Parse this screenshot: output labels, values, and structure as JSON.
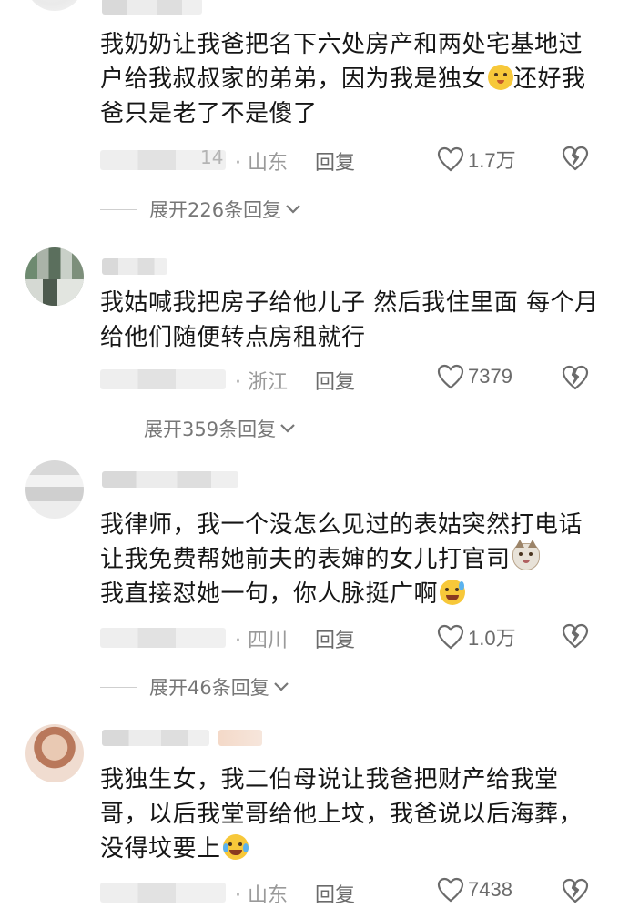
{
  "comments": [
    {
      "text": "我奶奶让我爸把名下六处房产和两处宅基地过户给我叔叔家的弟弟，因为我是独女",
      "text_after_emoji": "还好我爸只是老了不是傻了",
      "emoji_icon": "hush-face-emoji",
      "date_tail": "14",
      "location": "· 山东",
      "reply_label": "回复",
      "likes": "1.7万",
      "expand_label": "展开226条回复"
    },
    {
      "text": "我姑喊我把房子给他儿子 然后我住里面 每个月给他们随便转点房租就行",
      "date_tail": "",
      "location": "· 浙江",
      "reply_label": "回复",
      "likes": "7379",
      "expand_label": "展开359条回复"
    },
    {
      "text": "我律师，我一个没怎么见过的表姑突然打电话让我免费帮她前夫的表婶的女儿打官司",
      "text_middle": "我直接怼她一句，你人脉挺广啊",
      "emoji1_icon": "cat-face-emoji",
      "emoji2_icon": "sweat-smile-emoji",
      "date_tail": "",
      "location": "· 四川",
      "reply_label": "回复",
      "likes": "1.0万",
      "expand_label": "展开46条回复"
    },
    {
      "text": "我独生女，我二伯母说让我爸把财产给我堂哥，以后我堂哥给他上坟，我爸说以后海葬，没得坟要上",
      "emoji_icon": "laugh-cry-emoji",
      "date_tail": "",
      "location": "· 山东",
      "reply_label": "回复",
      "likes": "7438"
    }
  ],
  "colors": {
    "text": "#161616",
    "meta": "#9a9a9a",
    "accent_emoji": "#f7c83a"
  }
}
